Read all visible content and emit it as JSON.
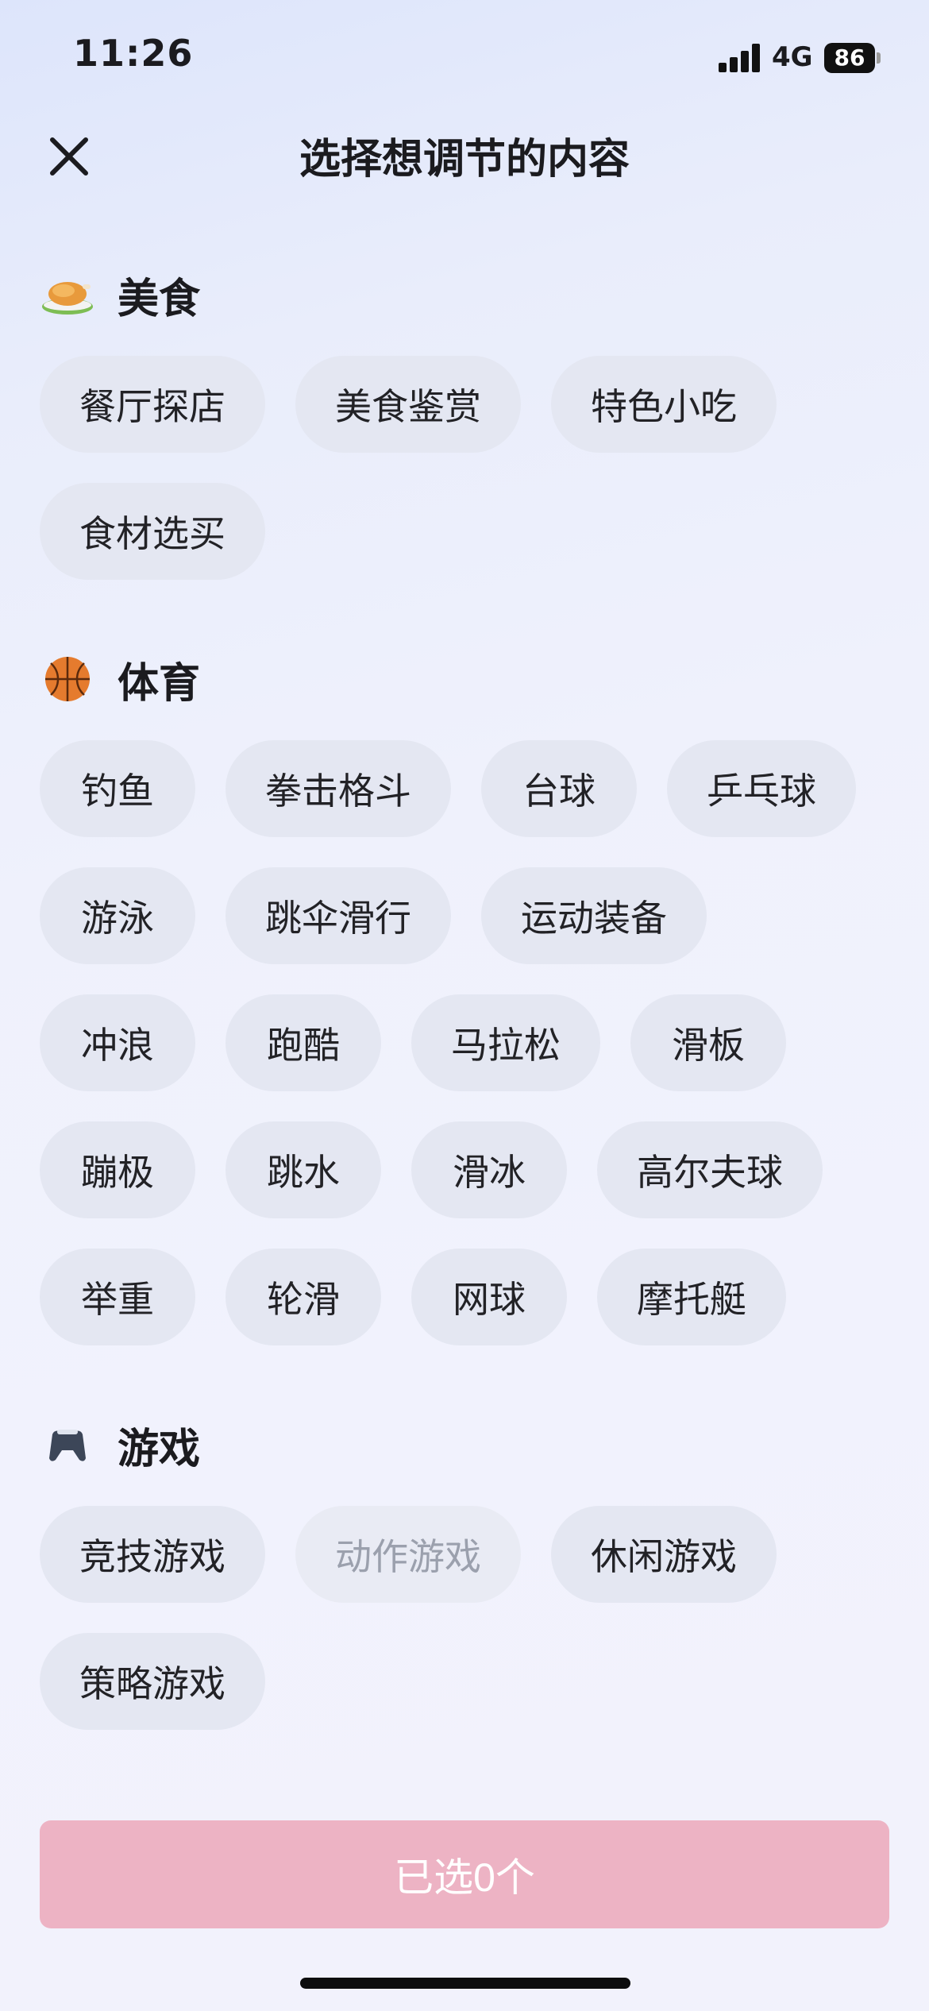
{
  "status_bar": {
    "time": "11:26",
    "network": "4G",
    "battery": "86"
  },
  "header": {
    "title": "选择想调节的内容",
    "close_icon": "close-icon"
  },
  "sections": [
    {
      "title": "美食",
      "icon": "roast-chicken-icon",
      "items": [
        "餐厅探店",
        "美食鉴赏",
        "特色小吃",
        "食材选买"
      ]
    },
    {
      "title": "体育",
      "icon": "basketball-icon",
      "items": [
        "钓鱼",
        "拳击格斗",
        "台球",
        "乒乓球",
        "游泳",
        "跳伞滑行",
        "运动装备",
        "冲浪",
        "跑酷",
        "马拉松",
        "滑板",
        "蹦极",
        "跳水",
        "滑冰",
        "高尔夫球",
        "举重",
        "轮滑",
        "网球",
        "摩托艇"
      ]
    },
    {
      "title": "游戏",
      "icon": "gamepad-icon",
      "items": [
        "竞技游戏",
        "动作游戏",
        "休闲游戏",
        "策略游戏"
      ],
      "disabled_items": [
        "动作游戏"
      ]
    }
  ],
  "footer": {
    "confirm_label": "已选0个"
  },
  "colors": {
    "chip_bg": "#e4e7f2",
    "confirm_bg": "#edb3c4",
    "text": "#1b1b1f"
  }
}
